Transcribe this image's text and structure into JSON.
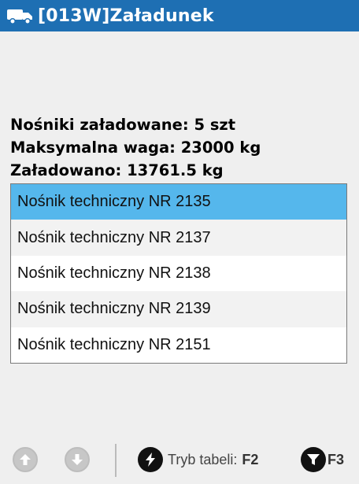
{
  "header": {
    "title": "[013W]Załadunek",
    "icon": "truck-icon",
    "bg": "#1e6fb3"
  },
  "info": {
    "loaded_count": "Nośniki załadowane: 5 szt",
    "max_weight": "Maksymalna waga: 23000 kg",
    "loaded_weight": "Załadowano: 13761.5 kg"
  },
  "list": {
    "selected_color": "#55b7ec",
    "items": [
      {
        "label": "Nośnik techniczny NR 2135",
        "selected": true
      },
      {
        "label": "Nośnik techniczny NR 2137",
        "selected": false
      },
      {
        "label": "Nośnik techniczny NR 2138",
        "selected": false
      },
      {
        "label": "Nośnik techniczny NR 2139",
        "selected": false
      },
      {
        "label": "Nośnik techniczny NR 2151",
        "selected": false
      }
    ]
  },
  "footer": {
    "up_icon": "arrow-up-icon",
    "down_icon": "arrow-down-icon",
    "mode_label": "Tryb tabeli:",
    "mode_key": "F2",
    "mode_icon": "lightning-icon",
    "filter_key": "F3",
    "filter_icon": "filter-icon"
  }
}
